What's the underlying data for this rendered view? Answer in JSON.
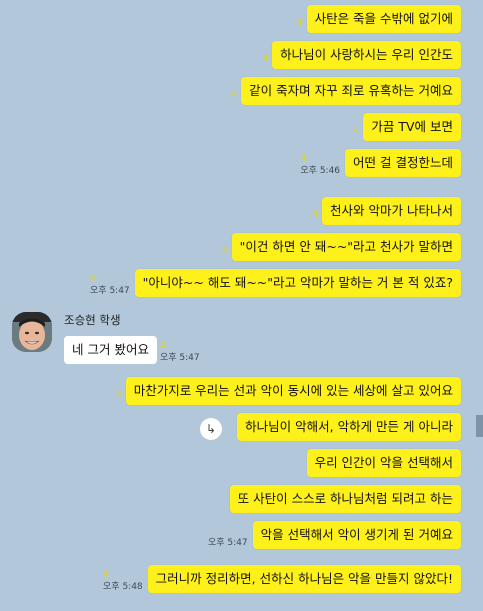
{
  "messages_outgoing": [
    {
      "text": "사탄은 죽을 수밖에 없기에",
      "read": "4",
      "time": ""
    },
    {
      "text": "하나님이 사랑하시는 우리 인간도",
      "read": "4",
      "time": ""
    },
    {
      "text": "같이 죽자며 자꾸 죄로 유혹하는 거예요",
      "read": "4",
      "time": ""
    },
    {
      "text": "가끔 TV에 보면",
      "read": "4",
      "time": ""
    },
    {
      "text": "어떤 걸 결정한느데",
      "read": "4",
      "time": "오후 5:46"
    },
    {
      "text": "천사와 악마가 나타나서",
      "read": "4",
      "time": ""
    },
    {
      "text": "\"이건 하면 안 돼~~\"라고 천사가 말하면",
      "read": "4",
      "time": ""
    },
    {
      "text": "\"아니야~~ 해도 돼~~\"라고 악마가 말하는 거 본 적 있죠?",
      "read": "4",
      "time": "오후 5:47"
    },
    {
      "text": "마찬가지로 우리는 선과 악이 동시에 있는 세상에 살고 있어요",
      "read": "4",
      "time": ""
    },
    {
      "text": "하나님이 악해서, 악하게 만든 게 아니라",
      "read": "",
      "time": ""
    },
    {
      "text": "우리 인간이 악을 선택해서",
      "read": "",
      "time": ""
    },
    {
      "text": "또 사탄이 스스로 하나님처럼 되려고 하는",
      "read": "",
      "time": ""
    },
    {
      "text": "악을 선택해서 악이 생기게 된 거예요",
      "read": "",
      "time": "오후 5:47"
    },
    {
      "text": "그러니까 정리하면, 선하신 하나님은 악을 만들지 않았다!",
      "read": "4",
      "time": "오후 5:48"
    }
  ],
  "incoming": {
    "sender": "조승현 학생",
    "text": "네 그거 봤어요",
    "read": "4",
    "time": "오후 5:47"
  },
  "colors": {
    "background": "#b2c7d9",
    "my_bubble": "#fef01b",
    "their_bubble": "#ffffff"
  },
  "icons": {
    "reply": "reply-arrow-icon"
  }
}
